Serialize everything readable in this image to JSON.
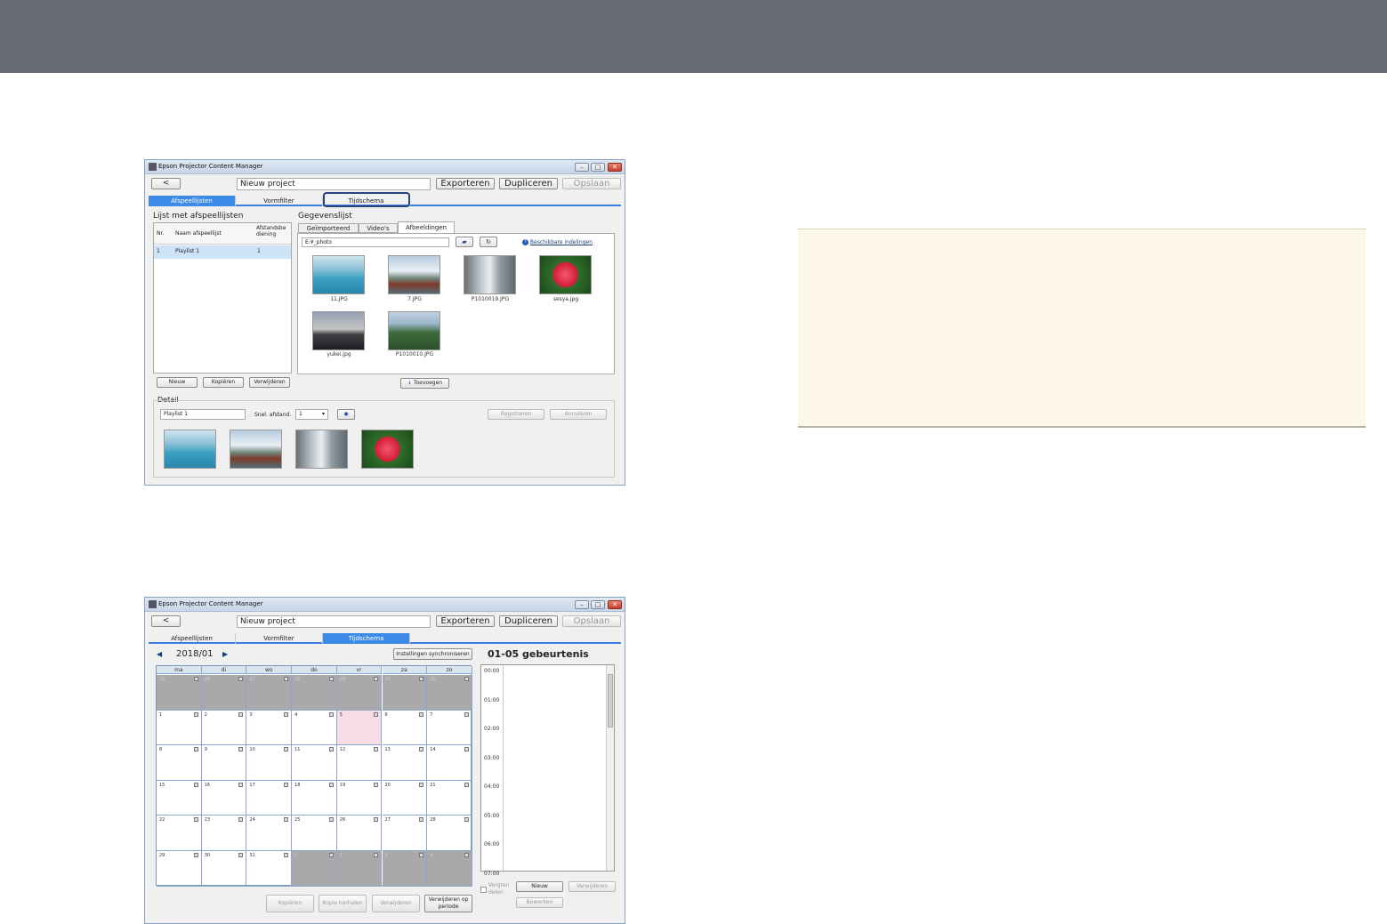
{
  "app_title": "Epson Projector Content Manager",
  "project_name": "Nieuw project",
  "toolbar": {
    "back": "<",
    "export": "Exporteren",
    "duplicate": "Dupliceren",
    "save": "Opslaan"
  },
  "window_controls": {
    "minimize": "–",
    "maximize": "□",
    "close": "✕"
  },
  "tabs": [
    "Afspeellijsten",
    "Vormfilter",
    "Tijdschema"
  ],
  "screen1": {
    "active_tab": 0,
    "highlighted_tab": 2,
    "playlist_panel": {
      "title": "Lijst met afspeellijsten",
      "columns": [
        "Nr.",
        "Naam afspeellijst",
        "Afstandsbe diening"
      ],
      "rows": [
        {
          "nr": "1",
          "name": "Playlist 1",
          "remote": "1"
        }
      ],
      "buttons": [
        "Nieuw",
        "Kopiëren",
        "Verwijderen"
      ]
    },
    "data_panel": {
      "title": "Gegevenslijst",
      "subtabs": [
        "Geïmporteerd",
        "Video's",
        "Afbeeldingen"
      ],
      "active_subtab": 2,
      "path": "E:¥_photo",
      "formats_link": "Beschikbare indelingen",
      "images": [
        "11.JPG",
        "7.JPG",
        "P1010019.JPG",
        "sesya.jpg",
        "yukei.jpg",
        "P1010010.JPG"
      ],
      "add_button": "Toevoegen"
    },
    "detail": {
      "title": "Detail",
      "name_value": "Playlist 1",
      "remote_label": "Snel. afstand.",
      "remote_value": "1",
      "register": "Registreren",
      "cancel": "Annuleren"
    }
  },
  "screen2": {
    "active_tab": 2,
    "month": "2018/01",
    "sync_button": "Instellingen synchroniseren",
    "event_title": "01-05 gebeurtenis",
    "weekdays": [
      "ma",
      "di",
      "wo",
      "do",
      "vr",
      "za",
      "zo"
    ],
    "prev_month_days": [
      "25",
      "26",
      "27",
      "28",
      "29",
      "30",
      "31"
    ],
    "days": [
      "1",
      "2",
      "3",
      "4",
      "5",
      "6",
      "7",
      "8",
      "9",
      "10",
      "11",
      "12",
      "13",
      "14",
      "15",
      "16",
      "17",
      "18",
      "19",
      "20",
      "21",
      "22",
      "23",
      "24",
      "25",
      "26",
      "27",
      "28",
      "29",
      "30",
      "31"
    ],
    "next_month_days": [
      "1",
      "2",
      "3",
      "4"
    ],
    "times": [
      "00:00",
      "01:00",
      "02:00",
      "03:00",
      "04:00",
      "05:00",
      "06:00",
      "07:00"
    ],
    "lock_label": "Vergren delen",
    "buttons": {
      "new": "Nieuw",
      "delete": "Verwijderen",
      "edit": "Bewerken",
      "copy": "Kopiëren",
      "copy_repeat": "Kopie herhalen",
      "delete2": "Verwijderen",
      "delete_period": "Verwijderen op periode"
    }
  }
}
